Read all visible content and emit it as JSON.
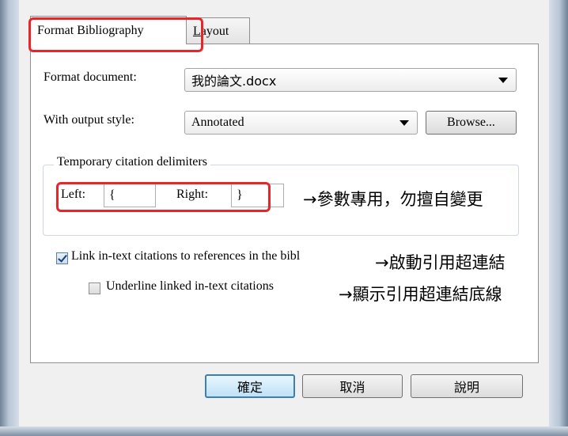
{
  "tabs": {
    "format_bibliography": "Format Bibliography",
    "layout": "Layout"
  },
  "format_document": {
    "label": "Format document:",
    "value": "我的論文.docx"
  },
  "output_style": {
    "label": "With output style:",
    "value": "Annotated",
    "browse_label": "Browse..."
  },
  "delimiters": {
    "group_title": "Temporary citation delimiters",
    "left_label": "Left:",
    "left_value": "{",
    "right_label": "Right:",
    "right_value": "}"
  },
  "options": {
    "link_citations": {
      "label": "Link in-text citations to references in the bibl",
      "checked": true
    },
    "underline_links": {
      "label": "Underline linked in-text citations",
      "checked": false
    }
  },
  "annotations": {
    "delimiters_note": "→參數專用，勿擅自變更",
    "link_note": "→啟動引用超連結",
    "underline_note_prefix": "→顯示引用",
    "underline_note_underlined": "超連結底線"
  },
  "buttons": {
    "ok": "確定",
    "cancel": "取消",
    "help": "說明"
  },
  "colors": {
    "annotation_border": "#e8262a",
    "dialog_bg": "#f0f0f0",
    "primary_button": "#3c7fb1"
  }
}
